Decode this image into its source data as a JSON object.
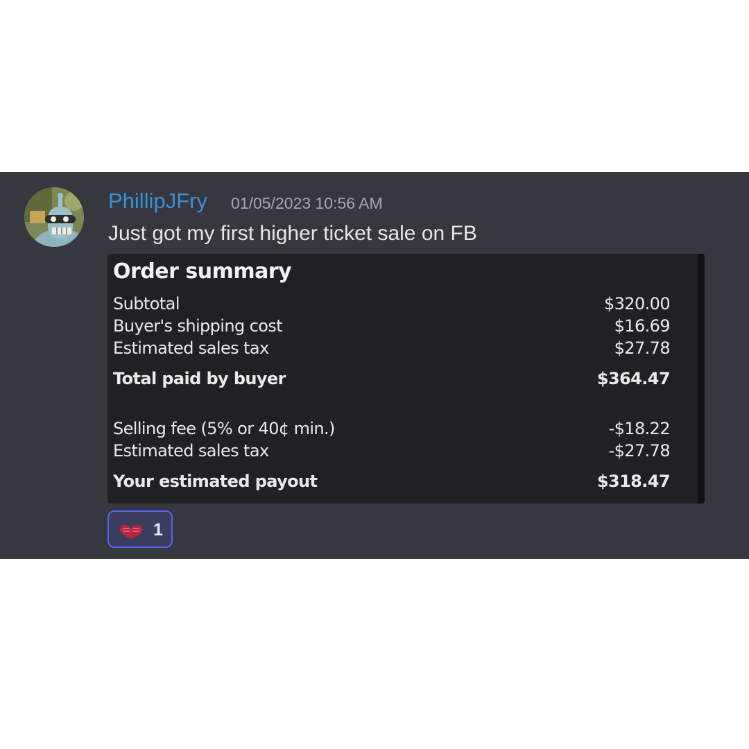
{
  "message": {
    "username": "PhillipJFry",
    "timestamp": "01/05/2023 10:56 AM",
    "text": "Just got my first higher ticket sale on FB"
  },
  "order_summary": {
    "title": "Order summary",
    "rows": [
      {
        "label": "Subtotal",
        "value": "$320.00"
      },
      {
        "label": "Buyer's shipping cost",
        "value": "$16.69"
      },
      {
        "label": "Estimated sales tax",
        "value": "$27.78"
      },
      {
        "label": "Total paid by buyer",
        "value": "$364.47"
      },
      {
        "label": "Selling fee (5% or 40¢ min.)",
        "value": "-$18.22"
      },
      {
        "label": "Estimated sales tax",
        "value": "-$27.78"
      },
      {
        "label": "Your estimated payout",
        "value": "$318.47"
      }
    ]
  },
  "reaction": {
    "emoji": "heart-hands-icon",
    "count": "1"
  },
  "colors": {
    "panel_bg": "#36383f",
    "username": "#3d8fd6",
    "card_bg": "#202124",
    "reaction_border": "#5865f2"
  }
}
